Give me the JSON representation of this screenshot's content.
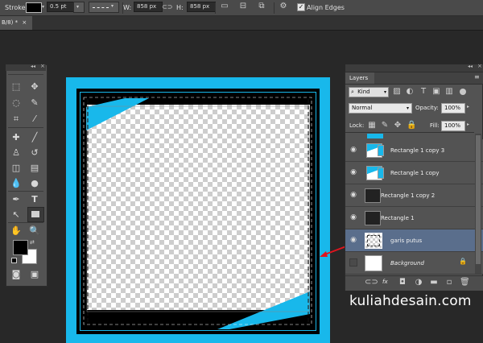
{
  "options_bar": {
    "stroke_label": "Stroke:",
    "stroke_width": "0.5 pt",
    "w_label": "W:",
    "w_value": "858 px",
    "h_label": "H:",
    "h_value": "858 px",
    "align_edges_label": "Align Edges",
    "align_edges_checked": true
  },
  "doc_tab": {
    "title": "B/8) *",
    "close_glyph": "×"
  },
  "layers_panel": {
    "title": "Layers",
    "filter_kind": "Kind",
    "blend_mode": "Normal",
    "opacity_label": "Opacity:",
    "opacity_value": "100%",
    "lock_label": "Lock:",
    "fill_label": "Fill:",
    "fill_value": "100%",
    "layers": [
      {
        "name": "Rectangle 1 copy 3",
        "selected": false
      },
      {
        "name": "Rectangle 1 copy",
        "selected": false
      },
      {
        "name": "Rectangle 1 copy 2",
        "selected": false
      },
      {
        "name": "Rectangle 1",
        "selected": false
      },
      {
        "name": "garis putus",
        "selected": true
      },
      {
        "name": "Background",
        "selected": false
      }
    ],
    "footer_fx": "fx"
  },
  "colors": {
    "accent_cyan": "#18b8eb",
    "annotation_red": "#e0141e",
    "selection_blue": "#5a6e8c"
  },
  "watermark": "kuliahdesain.com"
}
